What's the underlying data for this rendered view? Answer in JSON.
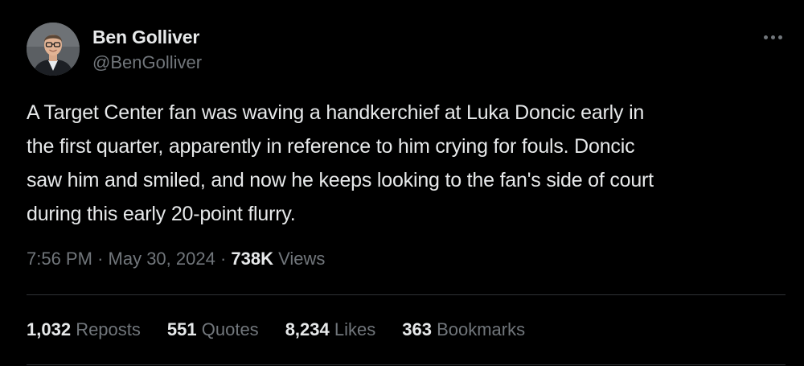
{
  "author": {
    "display_name": "Ben Golliver",
    "handle": "@BenGolliver",
    "avatar_icon": "profile-photo"
  },
  "more_icon": "ellipsis-icon",
  "tweet": {
    "lines": [
      "A Target Center fan was waving a handkerchief at Luka Doncic early in",
      "the first quarter, apparently in reference to him crying for fouls. Doncic",
      "saw him and smiled, and now he keeps looking to the fan's side of court",
      "during this early 20-point flurry."
    ]
  },
  "meta": {
    "time": "7:56 PM",
    "separator": "·",
    "date": "May 30, 2024",
    "views_count": "738K",
    "views_label": "Views"
  },
  "stats": [
    {
      "count": "1,032",
      "label": "Reposts"
    },
    {
      "count": "551",
      "label": "Quotes"
    },
    {
      "count": "8,234",
      "label": "Likes"
    },
    {
      "count": "363",
      "label": "Bookmarks"
    }
  ],
  "colors": {
    "background": "#000000",
    "primary_text": "#e7e9ea",
    "secondary_text": "#71767b",
    "divider": "#2f3336"
  }
}
